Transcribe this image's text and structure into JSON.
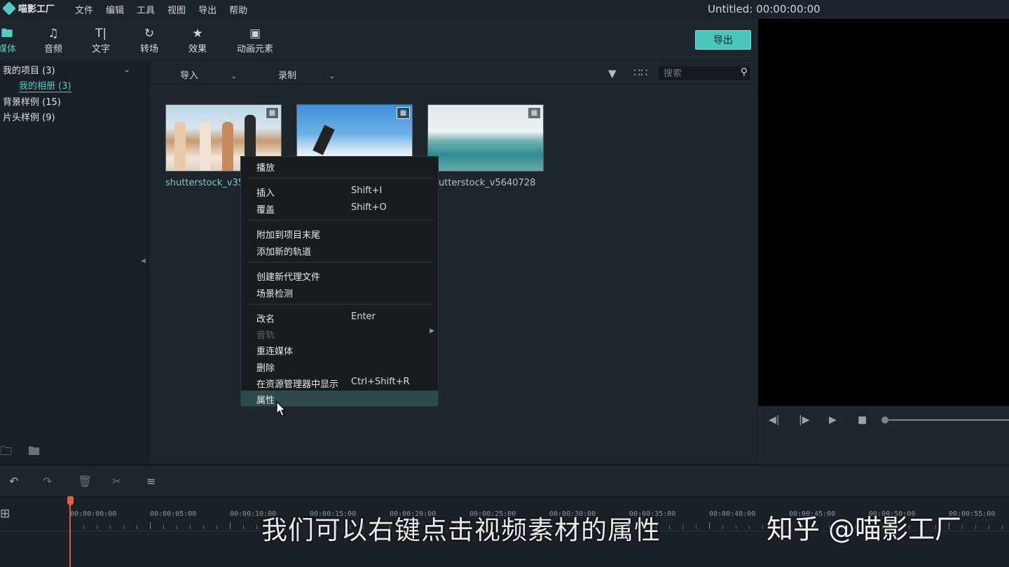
{
  "app": {
    "logo_text": "喵影工厂",
    "menu": [
      "文件",
      "编辑",
      "工具",
      "视图",
      "导出",
      "帮助"
    ],
    "project_title": "Untitled: 00:00:00:00"
  },
  "toolbar": {
    "tabs": [
      {
        "label": "媒体",
        "icon": "folder-icon"
      },
      {
        "label": "音频",
        "icon": "music-note-icon"
      },
      {
        "label": "文字",
        "icon": "text-icon"
      },
      {
        "label": "转场",
        "icon": "transition-icon"
      },
      {
        "label": "效果",
        "icon": "effects-icon"
      },
      {
        "label": "动画元素",
        "icon": "image-icon"
      }
    ],
    "export_label": "导出"
  },
  "tree": {
    "items": [
      {
        "label": "我的项目 (3)"
      },
      {
        "label": "我的相册 (3)"
      },
      {
        "label": "背景样例 (15)"
      },
      {
        "label": "片头样例 (9)"
      }
    ]
  },
  "media_bar": {
    "import_label": "导入",
    "record_label": "录制",
    "search_placeholder": "搜索"
  },
  "clips": [
    {
      "name": "shutterstock_v35"
    },
    {
      "name": ""
    },
    {
      "name": "utterstock_v5640728"
    }
  ],
  "context_menu": {
    "items": [
      {
        "label": "播放",
        "shortcut": ""
      },
      {
        "label": "插入",
        "shortcut": "Shift+I"
      },
      {
        "label": "覆盖",
        "shortcut": "Shift+O"
      },
      {
        "label": "附加到项目末尾",
        "shortcut": ""
      },
      {
        "label": "添加新的轨道",
        "shortcut": ""
      },
      {
        "label": "创建新代理文件",
        "shortcut": ""
      },
      {
        "label": "场景检测",
        "shortcut": ""
      },
      {
        "label": "改名",
        "shortcut": "Enter"
      },
      {
        "label": "音轨",
        "shortcut": ""
      },
      {
        "label": "重连媒体",
        "shortcut": ""
      },
      {
        "label": "删除",
        "shortcut": ""
      },
      {
        "label": "在资源管理器中显示",
        "shortcut": "Ctrl+Shift+R"
      },
      {
        "label": "属性",
        "shortcut": ""
      }
    ],
    "selected": "属性"
  },
  "timeline": {
    "tick_labels": [
      "00:00:00:00",
      "00:00:05:00",
      "00:00:10:00",
      "00:00:15:00",
      "00:00:20:00",
      "00:00:25:00",
      "00:00:30:00",
      "00:00:35:00",
      "00:00:40:00",
      "00:00:45:00",
      "00:00:50:00",
      "00:00:55:00"
    ]
  },
  "overlay": {
    "subtitle": "我们可以右键点击视频素材的属性",
    "watermark": "知乎 @喵影工厂"
  },
  "colors": {
    "accent": "#57c9c4",
    "playhead": "#e0553f",
    "background": "#1e252c"
  }
}
